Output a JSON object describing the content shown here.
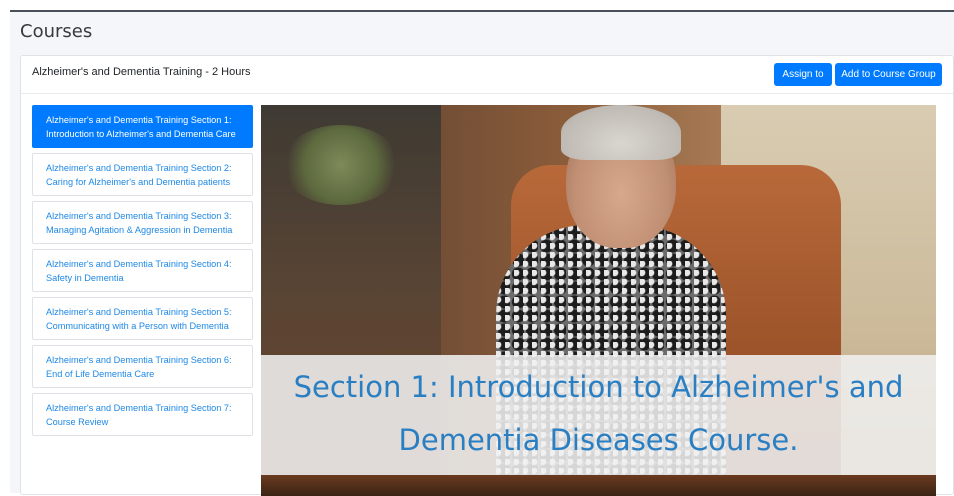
{
  "page": {
    "title": "Courses"
  },
  "course": {
    "title": "Alzheimer's and Dementia Training - 2 Hours",
    "assign_label": "Assign to",
    "add_group_label": "Add to Course Group"
  },
  "sections": [
    {
      "label": "Alzheimer's and Dementia Training Section 1: Introduction to Alzheimer's and Dementia Care",
      "active": true
    },
    {
      "label": "Alzheimer's and Dementia Training Section 2: Caring for Alzheimer's and Dementia patients",
      "active": false
    },
    {
      "label": "Alzheimer's and Dementia Training Section 3: Managing Agitation & Aggression in Dementia",
      "active": false
    },
    {
      "label": "Alzheimer's and Dementia Training Section 4: Safety in Dementia",
      "active": false
    },
    {
      "label": "Alzheimer's and Dementia Training Section 5: Communicating with a Person with Dementia",
      "active": false
    },
    {
      "label": "Alzheimer's and Dementia Training Section 6: End of Life Dementia Care",
      "active": false
    },
    {
      "label": "Alzheimer's and Dementia Training Section 7: Course Review",
      "active": false
    }
  ],
  "video": {
    "caption_line1": "Section 1: Introduction to Alzheimer's and",
    "caption_line2": "Dementia Diseases Course."
  },
  "colors": {
    "accent": "#007bff",
    "link": "#1e88e5",
    "caption": "#2a7fc3"
  }
}
